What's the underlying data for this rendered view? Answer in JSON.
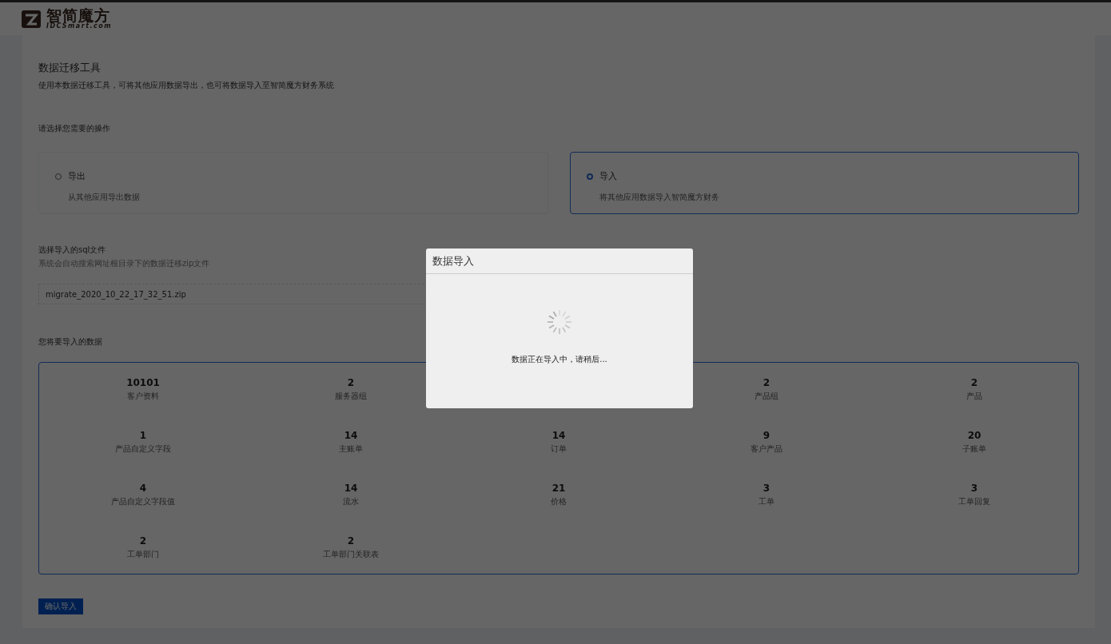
{
  "logo": {
    "name": "智简魔方",
    "domain": "IDCSmart.com"
  },
  "page": {
    "title": "数据迁移工具",
    "description": "使用本数据迁移工具，可将其他应用数据导出，也可将数据导入至智简魔方财务系统"
  },
  "operation": {
    "label": "请选择您需要的操作",
    "options": [
      {
        "title": "导出",
        "description": "从其他应用导出数据",
        "selected": false
      },
      {
        "title": "导入",
        "description": "将其他应用数据导入智简魔方财务",
        "selected": true
      }
    ]
  },
  "file": {
    "label": "选择导入的sql文件",
    "hint": "系统会自动搜索网址根目录下的数据迁移zip文件",
    "value": "migrate_2020_10_22_17_32_51.zip"
  },
  "data": {
    "label": "您将要导入的数据",
    "items": [
      {
        "kind": "stat",
        "count": "10101",
        "label": "客户资料"
      },
      {
        "kind": "stat",
        "count": "2",
        "label": "服务器组"
      },
      {
        "kind": "covered"
      },
      {
        "kind": "stat",
        "count": "2",
        "label": "产品组"
      },
      {
        "kind": "stat",
        "count": "2",
        "label": "产品"
      },
      {
        "kind": "stat",
        "count": "1",
        "label": "产品自定义字段"
      },
      {
        "kind": "stat",
        "count": "14",
        "label": "主账单"
      },
      {
        "kind": "stat",
        "count": "14",
        "label": "订单"
      },
      {
        "kind": "stat",
        "count": "9",
        "label": "客户产品"
      },
      {
        "kind": "stat",
        "count": "20",
        "label": "子账单"
      },
      {
        "kind": "stat",
        "count": "4",
        "label": "产品自定义字段值"
      },
      {
        "kind": "stat",
        "count": "14",
        "label": "流水"
      },
      {
        "kind": "stat",
        "count": "21",
        "label": "价格"
      },
      {
        "kind": "stat",
        "count": "3",
        "label": "工单"
      },
      {
        "kind": "stat",
        "count": "3",
        "label": "工单回复"
      },
      {
        "kind": "stat",
        "count": "2",
        "label": "工单部门"
      },
      {
        "kind": "stat",
        "count": "2",
        "label": "工单部门关联表"
      }
    ]
  },
  "confirm_button": "确认导入",
  "modal": {
    "title": "数据导入",
    "message": "数据正在导入中，请稍后..."
  }
}
